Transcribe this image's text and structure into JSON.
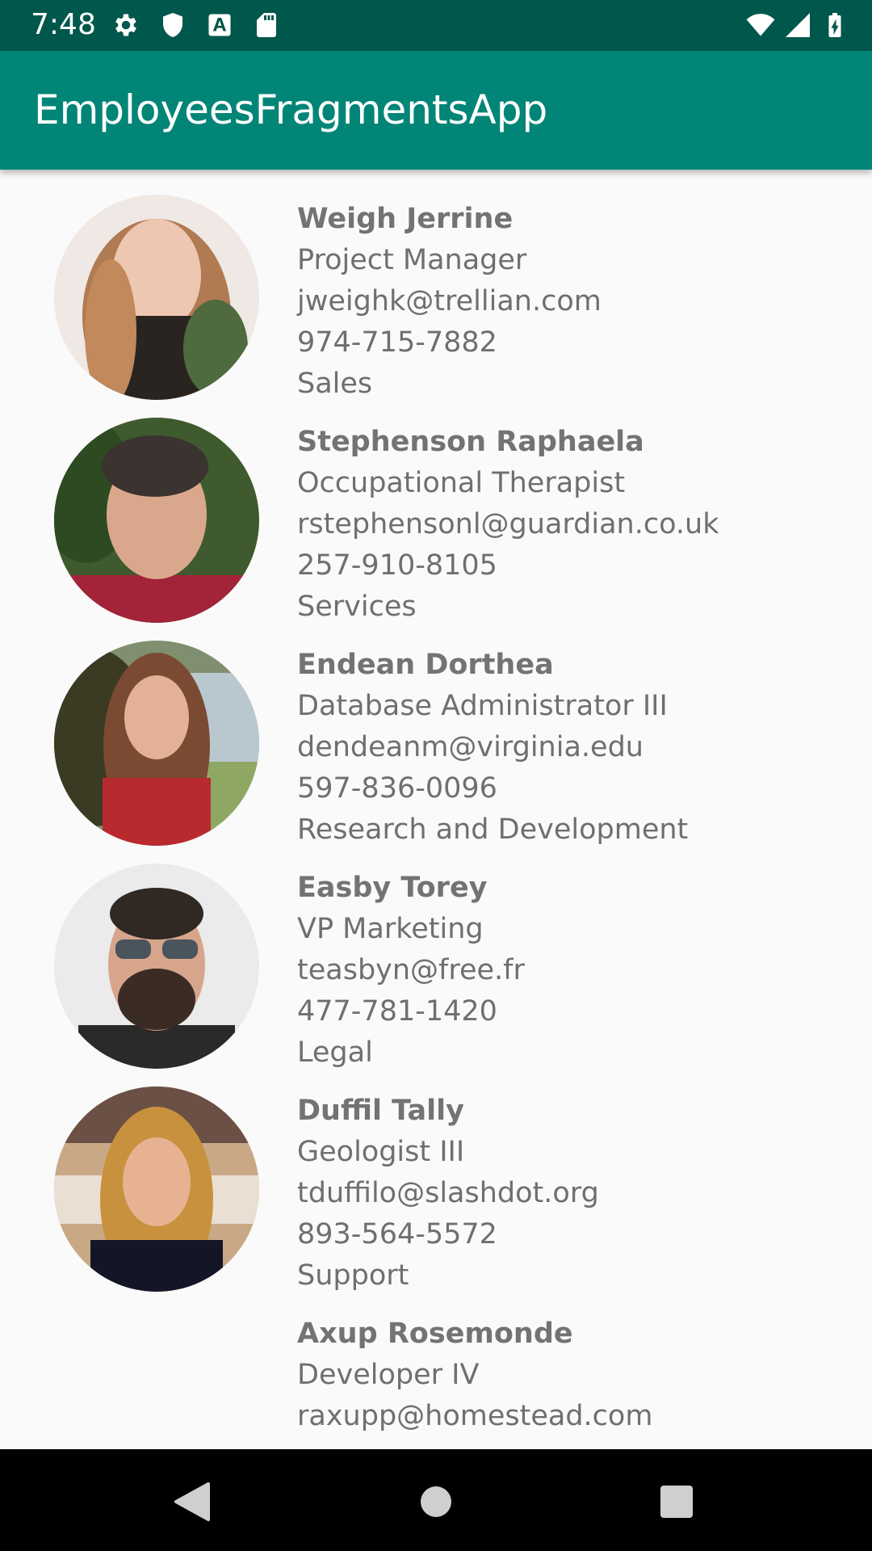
{
  "status_bar": {
    "time": "7:48",
    "icons": [
      "settings-icon",
      "shield-icon",
      "font-a-icon",
      "sd-card-icon",
      "wifi-icon",
      "signal-icon",
      "battery-charging-icon"
    ],
    "background": "#00574b"
  },
  "app_bar": {
    "title": "EmployeesFragmentsApp",
    "background": "#008577"
  },
  "employees": [
    {
      "name": "Weigh Jerrine",
      "title": "Project Manager",
      "email": "jweighk@trellian.com",
      "phone": "974-715-7882",
      "department": "Sales",
      "has_avatar": true
    },
    {
      "name": "Stephenson Raphaela",
      "title": "Occupational Therapist",
      "email": "rstephensonl@guardian.co.uk",
      "phone": "257-910-8105",
      "department": "Services",
      "has_avatar": true
    },
    {
      "name": "Endean Dorthea",
      "title": "Database Administrator III",
      "email": "dendeanm@virginia.edu",
      "phone": "597-836-0096",
      "department": "Research and Development",
      "has_avatar": true
    },
    {
      "name": "Easby Torey",
      "title": "VP Marketing",
      "email": "teasbyn@free.fr",
      "phone": "477-781-1420",
      "department": "Legal",
      "has_avatar": true
    },
    {
      "name": "Duffil Tally",
      "title": "Geologist III",
      "email": "tduffilo@slashdot.org",
      "phone": "893-564-5572",
      "department": "Support",
      "has_avatar": true
    },
    {
      "name": "Axup Rosemonde",
      "title": "Developer IV",
      "email": "raxupp@homestead.com",
      "phone": "",
      "department": "",
      "has_avatar": false
    }
  ],
  "nav_bar": {
    "buttons": [
      "back-icon",
      "home-icon",
      "recents-icon"
    ]
  }
}
